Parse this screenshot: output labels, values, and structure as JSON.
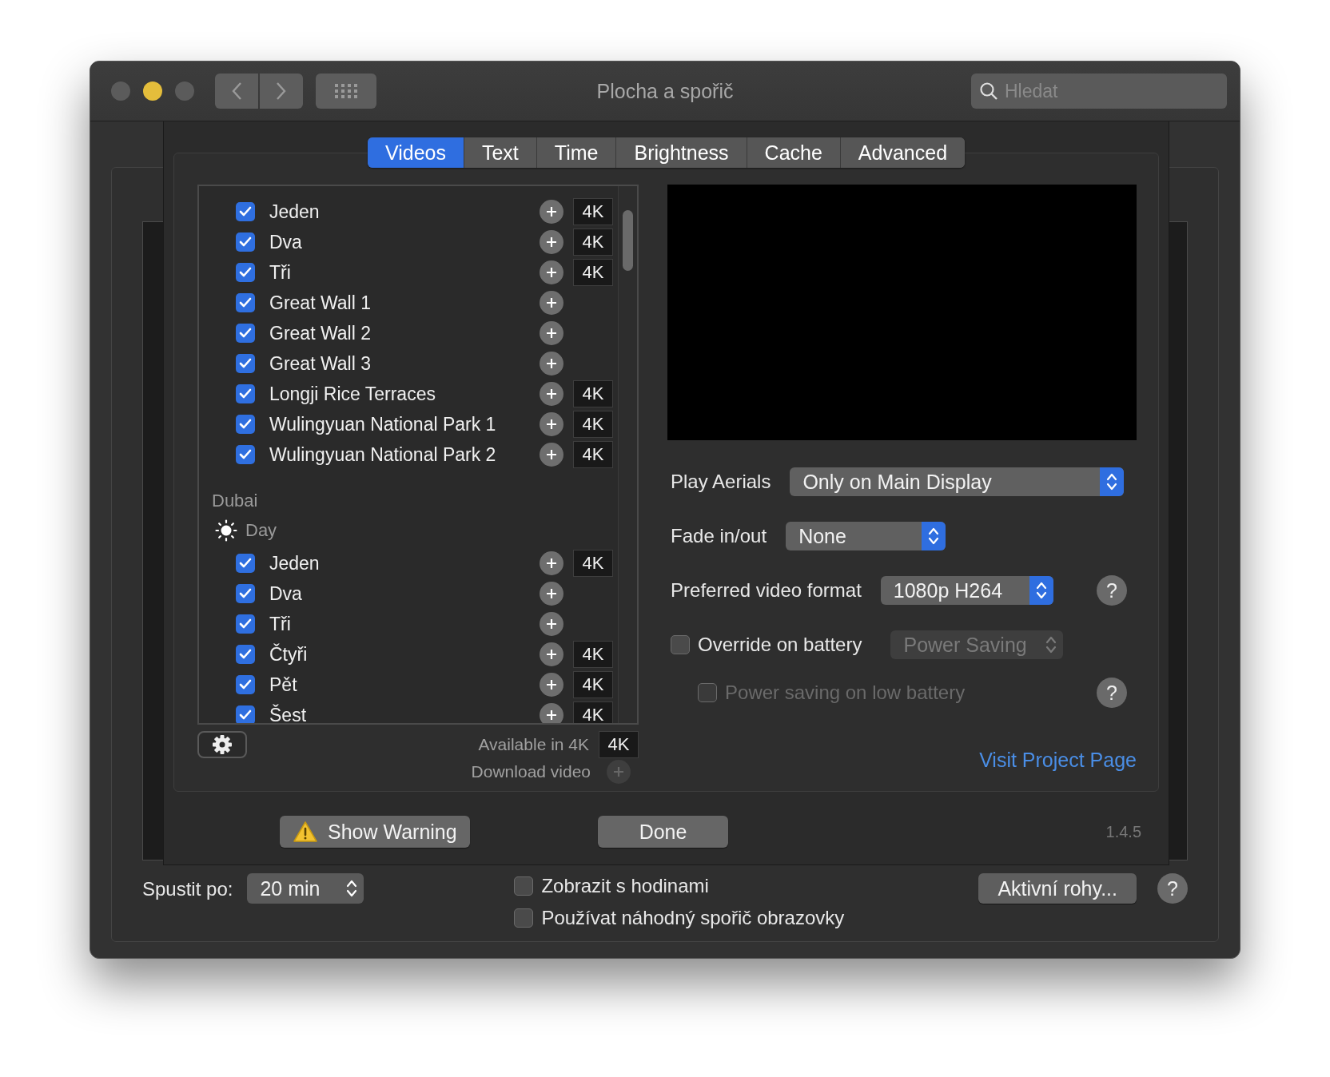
{
  "window": {
    "title": "Plocha a spořič",
    "search": {
      "placeholder": "Hledat"
    }
  },
  "tabs": [
    {
      "label": "Videos",
      "selected": true
    },
    {
      "label": "Text",
      "selected": false
    },
    {
      "label": "Time",
      "selected": false
    },
    {
      "label": "Brightness",
      "selected": false
    },
    {
      "label": "Cache",
      "selected": false
    },
    {
      "label": "Advanced",
      "selected": false
    }
  ],
  "video_list": {
    "items": [
      {
        "kind": "video",
        "name": "Jeden",
        "checked": true,
        "badge": "4K"
      },
      {
        "kind": "video",
        "name": "Dva",
        "checked": true,
        "badge": "4K"
      },
      {
        "kind": "video",
        "name": "Tři",
        "checked": true,
        "badge": "4K"
      },
      {
        "kind": "video",
        "name": "Great Wall 1",
        "checked": true
      },
      {
        "kind": "video",
        "name": "Great Wall 2",
        "checked": true
      },
      {
        "kind": "video",
        "name": "Great Wall 3",
        "checked": true
      },
      {
        "kind": "video",
        "name": "Longji Rice Terraces",
        "checked": true,
        "badge": "4K"
      },
      {
        "kind": "video",
        "name": "Wulingyuan National Park 1",
        "checked": true,
        "badge": "4K"
      },
      {
        "kind": "video",
        "name": "Wulingyuan National Park 2",
        "checked": true,
        "badge": "4K"
      },
      {
        "kind": "location",
        "label": "Dubai"
      },
      {
        "kind": "time",
        "label": "Day"
      },
      {
        "kind": "video",
        "name": "Jeden",
        "checked": true,
        "badge": "4K"
      },
      {
        "kind": "video",
        "name": "Dva",
        "checked": true
      },
      {
        "kind": "video",
        "name": "Tři",
        "checked": true
      },
      {
        "kind": "video",
        "name": "Čtyři",
        "checked": true,
        "badge": "4K"
      },
      {
        "kind": "video",
        "name": "Pět",
        "checked": true,
        "badge": "4K"
      },
      {
        "kind": "video",
        "name": "Šest",
        "checked": true,
        "badge": "4K"
      }
    ]
  },
  "legend": {
    "available_label": "Available in 4K",
    "badge": "4K",
    "download_label": "Download video"
  },
  "settings": {
    "play_aerials": {
      "label": "Play Aerials",
      "value": "Only on Main Display",
      "disabled": false
    },
    "fade": {
      "label": "Fade in/out",
      "value": "None",
      "disabled": false
    },
    "format": {
      "label": "Preferred video format",
      "value": "1080p H264",
      "disabled": false,
      "help": "?"
    },
    "override": {
      "label": "Override on battery",
      "checked": false,
      "value": "Power Saving",
      "disabled": true
    },
    "low_battery": {
      "label": "Power saving on low battery",
      "checked": false,
      "disabled": true,
      "help": "?"
    },
    "link": "Visit Project Page"
  },
  "sheet_buttons": [
    {
      "label": "Show Warning",
      "kind": "warning"
    },
    {
      "label": "Done",
      "kind": "plain"
    }
  ],
  "version": "1.4.5",
  "footer": {
    "start_label": "Spustit po:",
    "start_value": "20 min",
    "checkboxes": [
      {
        "label": "Zobrazit s hodinami",
        "checked": false
      },
      {
        "label": "Používat náhodný spořič obrazovky",
        "checked": false
      }
    ],
    "hot_corners": "Aktivní rohy...",
    "help": "?"
  }
}
